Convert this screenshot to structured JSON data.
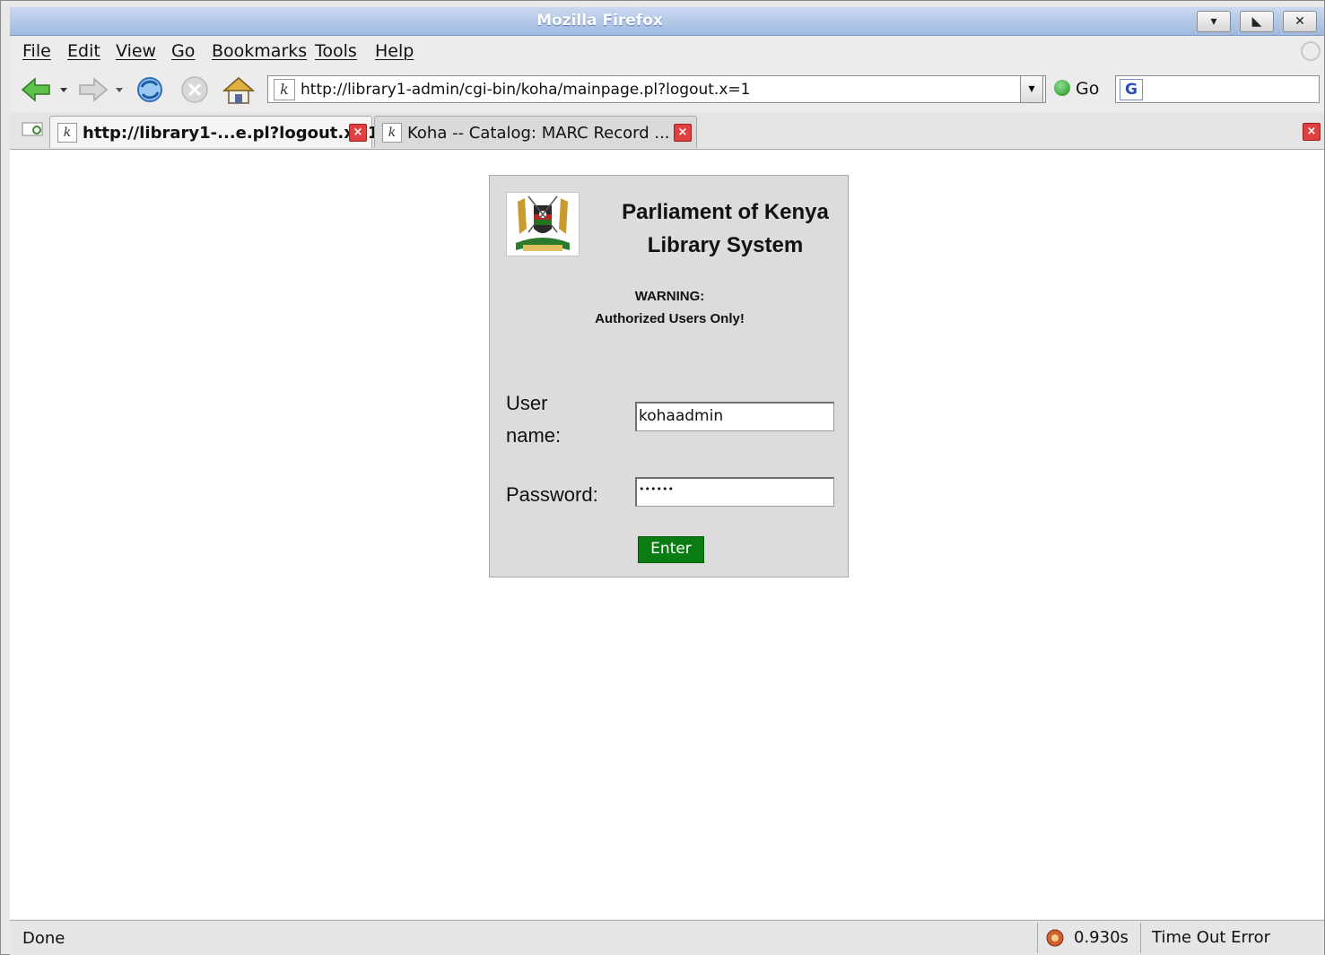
{
  "window": {
    "title": "Mozilla Firefox",
    "buttons": [
      "▾",
      "◣",
      "✕"
    ]
  },
  "menubar": [
    "File",
    "Edit",
    "View",
    "Go",
    "Bookmarks",
    "Tools",
    "Help"
  ],
  "navbar": {
    "url": "http://library1-admin/cgi-bin/koha/mainpage.pl?logout.x=1",
    "favicon_letter": "k",
    "go_label": "Go",
    "search_engine_glyph": "G"
  },
  "tabs": [
    {
      "label": "http://library1-...e.pl?logout.x=1",
      "active": true
    },
    {
      "label": "Koha -- Catalog: MARC Record ...",
      "active": false
    }
  ],
  "login": {
    "org_line1": "Parliament of Kenya",
    "org_line2": "Library System",
    "warning_line1": "WARNING:",
    "warning_line2": "Authorized Users Only!",
    "username_label_1": "User",
    "username_label_2": "name:",
    "username_value": "kohaadmin",
    "password_label": "Password:",
    "password_value": "••••••",
    "enter_label": "Enter"
  },
  "status": {
    "text": "Done",
    "timing": "0.930s",
    "error": "Time Out Error"
  },
  "colors": {
    "title_bar": "#9fb9e0",
    "enter_button": "#0a7d12",
    "login_panel": "#dcdcdc"
  },
  "icons": [
    "back-icon",
    "forward-icon",
    "reload-icon",
    "stop-icon",
    "home-icon",
    "go-icon",
    "google-icon",
    "new-tab-icon",
    "close-tab-icon",
    "coat-of-arms-icon",
    "status-extension-icon"
  ]
}
